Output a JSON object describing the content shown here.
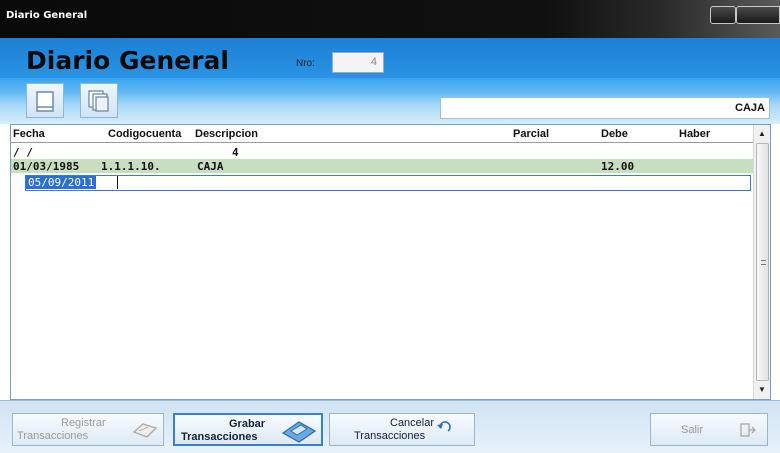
{
  "window": {
    "title": "Diario General"
  },
  "header": {
    "title": "Diario General",
    "nro_label": "Nro:",
    "nro_value": "4"
  },
  "toolbar": {
    "account_display": "CAJA"
  },
  "grid": {
    "columns": [
      "Fecha",
      "Codigocuenta",
      "Descripcion",
      "Parcial",
      "Debe",
      "Haber"
    ],
    "rows": [
      {
        "fecha": "/ /",
        "codigo": "",
        "descripcion": "4",
        "parcial": "",
        "debe": "",
        "haber": ""
      },
      {
        "fecha": "01/03/1985",
        "codigo": "1.1.1.10.",
        "descripcion": "CAJA",
        "parcial": "",
        "debe": "12.00",
        "haber": ""
      },
      {
        "fecha": "05/09/2011",
        "codigo": "",
        "descripcion": "",
        "parcial": "",
        "debe": "",
        "haber": ""
      }
    ]
  },
  "actions": {
    "registrar": {
      "line1": "Registrar",
      "line2": "Transacciones",
      "enabled": false
    },
    "grabar": {
      "line1": "Grabar",
      "line2": "Transacciones",
      "enabled": true
    },
    "cancelar": {
      "line1": "Cancelar",
      "line2": "Transacciones",
      "enabled": true
    },
    "salir": {
      "label": "Salir",
      "enabled": false
    }
  },
  "colors": {
    "header_blue": "#1c7fd4",
    "selected_row": "#c7dfc0",
    "edit_highlight": "#2a6fd6"
  },
  "icons": [
    "new-document-icon",
    "copy-documents-icon",
    "registrar-icon",
    "grabar-disk-icon",
    "cancelar-undo-icon",
    "exit-door-icon",
    "scroll-up-icon",
    "scroll-down-icon"
  ]
}
